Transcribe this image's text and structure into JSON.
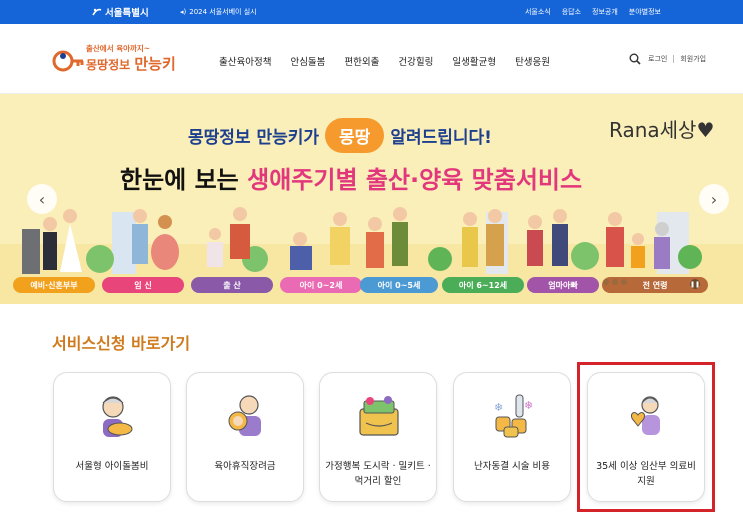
{
  "topbar": {
    "city_logo": "서울특별시",
    "notice": "2024 서울서베이 실시",
    "links": [
      "서울소식",
      "응답소",
      "정보공개",
      "분야별정보"
    ]
  },
  "header": {
    "brand_line1": "출산에서 육아까지~",
    "brand_line2_a": "몽땅정보 ",
    "brand_line2_b": "만능키",
    "nav": [
      "출산육아정책",
      "안심돌봄",
      "편한외출",
      "건강힐링",
      "일생활균형",
      "탄생응원"
    ],
    "login": "로그인",
    "signup": "회원가입"
  },
  "banner": {
    "line1_a": "몽땅정보 만능키가",
    "line1_badge": "몽땅",
    "line1_b": "알려드립니다!",
    "watermark": "Rana세상♥",
    "line2_a": "한눈에 보는 ",
    "line2_hl": "생애주기별 출산·양육 맞춤서비스",
    "stages": [
      {
        "label": "예비·신혼부부",
        "color": "#f2a11d"
      },
      {
        "label": "임 신",
        "color": "#e8457a"
      },
      {
        "label": "출 산",
        "color": "#8a5aa8"
      },
      {
        "label": "아이 0~2세",
        "color": "#ea6bb3"
      },
      {
        "label": "아이 0~5세",
        "color": "#4c9ad4"
      },
      {
        "label": "아이 6~12세",
        "color": "#4cad59"
      },
      {
        "label": "엄마아빠",
        "color": "#a255a8"
      },
      {
        "label": "전 연령",
        "color": "#b7693a"
      }
    ]
  },
  "services": {
    "title": "서비스신청 바로가기",
    "cards": [
      {
        "label": "서울형 아이돌봄비",
        "icon": "grandma-baby-icon"
      },
      {
        "label": "육아휴직장려금",
        "icon": "parent-baby-icon"
      },
      {
        "label": "가정행복 도시락 · 밀키트 · 먹거리 할인",
        "icon": "lunchbox-icon"
      },
      {
        "label": "난자동결 시술 비용",
        "icon": "egg-freezing-icon"
      },
      {
        "label": "35세 이상 임산부 의료비 지원",
        "icon": "pregnant-heart-icon"
      }
    ]
  }
}
